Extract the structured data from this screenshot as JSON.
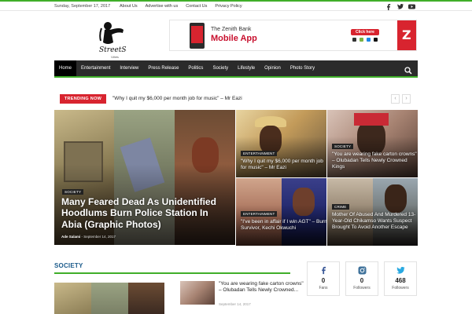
{
  "topbar": {
    "date": "Sunday, September 17, 2017",
    "links": [
      "About Us",
      "Advertise with us",
      "Contact Us",
      "Privacy Policy"
    ],
    "social_icons": [
      "facebook-icon",
      "twitter-icon",
      "youtube-icon"
    ]
  },
  "header": {
    "logo_caption": "Vibes",
    "banner": {
      "line1": "The Zenith Bank",
      "line2": "Mobile App",
      "cta": "Click here"
    }
  },
  "nav": {
    "items": [
      "Home",
      "Entertainment",
      "Interview",
      "Press Release",
      "Politics",
      "Society",
      "Lifestyle",
      "Opinion",
      "Photo Story"
    ],
    "active": "Home"
  },
  "trending": {
    "label": "TRENDING NOW",
    "headline": "\"Why I quit my $6,000 per month job for music\" – Mr Eazi"
  },
  "featured": {
    "main": {
      "category": "SOCIETY",
      "title": "Many Feared Dead As Unidentified Hoodlums Burn Police Station In Abia (Graphic Photos)",
      "author": "Ade Salami",
      "date": "September 14, 2017"
    },
    "top_left": {
      "category": "ENTERTAINMENT",
      "title": "\"Why I quit my $6,000 per month job for music\" – Mr Eazi"
    },
    "top_right": {
      "category": "SOCIETY",
      "title": "\"You are wearing fake carton crowns\" – Olubadan Tells Newly Crowned Kings"
    },
    "bottom_left": {
      "category": "ENTERTAINMENT",
      "title": "\"I've been in affair if I win AGT\" – Burn Survivor, Kechi Okwuchi"
    },
    "bottom_right": {
      "category": "CRIME",
      "title": "Mother Of Abused And Murdered 13-Year-Old Chikamso Wants Suspect Brought To Avoid Another Escape"
    }
  },
  "section": {
    "title": "SOCIETY",
    "story": {
      "title": "\"You are wearing fake carton crowns\" – Olubadan Tells Newly Crowned...",
      "date": "September 14, 2017"
    }
  },
  "social_counters": [
    {
      "icon": "facebook-icon",
      "count": "0",
      "label": "Fans"
    },
    {
      "icon": "instagram-icon",
      "count": "0",
      "label": "Followers"
    },
    {
      "icon": "twitter-icon",
      "count": "468",
      "label": "Followers"
    }
  ],
  "colors": {
    "accent_green": "#3fae29",
    "nav_dark": "#2b2b2b",
    "trending_red": "#d8242f",
    "section_blue": "#1b5b8b"
  }
}
